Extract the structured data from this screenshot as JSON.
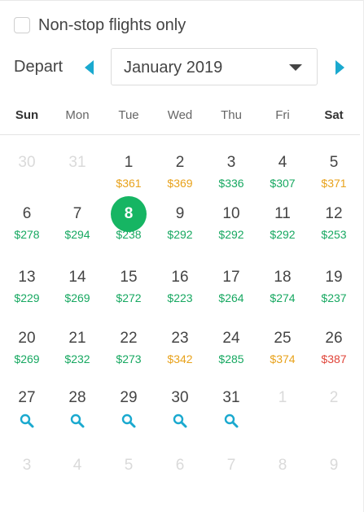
{
  "filters": {
    "nonstop_label": "Non-stop flights only",
    "nonstop_checked": false
  },
  "depart": {
    "label": "Depart",
    "month": "January 2019"
  },
  "weekdays": [
    "Sun",
    "Mon",
    "Tue",
    "Wed",
    "Thu",
    "Fri",
    "Sat"
  ],
  "colors": {
    "accent": "#16b563",
    "arrow": "#1aa9cf",
    "cheap": "#17a861",
    "mid": "#e8a21b",
    "expensive": "#e0453a"
  },
  "weeks": [
    [
      {
        "d": "30",
        "muted": true
      },
      {
        "d": "31",
        "muted": true
      },
      {
        "d": "1",
        "price": "$361",
        "level": "orange"
      },
      {
        "d": "2",
        "price": "$369",
        "level": "orange"
      },
      {
        "d": "3",
        "price": "$336",
        "level": "green"
      },
      {
        "d": "4",
        "price": "$307",
        "level": "green"
      },
      {
        "d": "5",
        "price": "$371",
        "level": "orange"
      }
    ],
    [
      {
        "d": "6",
        "price": "$278",
        "level": "green"
      },
      {
        "d": "7",
        "price": "$294",
        "level": "green"
      },
      {
        "d": "8",
        "price": "$238",
        "level": "green",
        "selected": true
      },
      {
        "d": "9",
        "price": "$292",
        "level": "green"
      },
      {
        "d": "10",
        "price": "$292",
        "level": "green"
      },
      {
        "d": "11",
        "price": "$292",
        "level": "green"
      },
      {
        "d": "12",
        "price": "$253",
        "level": "green"
      }
    ],
    [
      {
        "d": "13",
        "price": "$229",
        "level": "green"
      },
      {
        "d": "14",
        "price": "$269",
        "level": "green"
      },
      {
        "d": "15",
        "price": "$272",
        "level": "green"
      },
      {
        "d": "16",
        "price": "$223",
        "level": "green"
      },
      {
        "d": "17",
        "price": "$264",
        "level": "green"
      },
      {
        "d": "18",
        "price": "$274",
        "level": "green"
      },
      {
        "d": "19",
        "price": "$237",
        "level": "green"
      }
    ],
    [
      {
        "d": "20",
        "price": "$269",
        "level": "green"
      },
      {
        "d": "21",
        "price": "$232",
        "level": "green"
      },
      {
        "d": "22",
        "price": "$273",
        "level": "green"
      },
      {
        "d": "23",
        "price": "$342",
        "level": "orange"
      },
      {
        "d": "24",
        "price": "$285",
        "level": "green"
      },
      {
        "d": "25",
        "price": "$374",
        "level": "orange"
      },
      {
        "d": "26",
        "price": "$387",
        "level": "red"
      }
    ],
    [
      {
        "d": "27",
        "search": true
      },
      {
        "d": "28",
        "search": true
      },
      {
        "d": "29",
        "search": true
      },
      {
        "d": "30",
        "search": true
      },
      {
        "d": "31",
        "search": true
      },
      {
        "d": "1",
        "muted": true
      },
      {
        "d": "2",
        "muted": true
      }
    ],
    [
      {
        "d": "3",
        "muted": true
      },
      {
        "d": "4",
        "muted": true
      },
      {
        "d": "5",
        "muted": true
      },
      {
        "d": "6",
        "muted": true
      },
      {
        "d": "7",
        "muted": true
      },
      {
        "d": "8",
        "muted": true
      },
      {
        "d": "9",
        "muted": true
      }
    ]
  ]
}
